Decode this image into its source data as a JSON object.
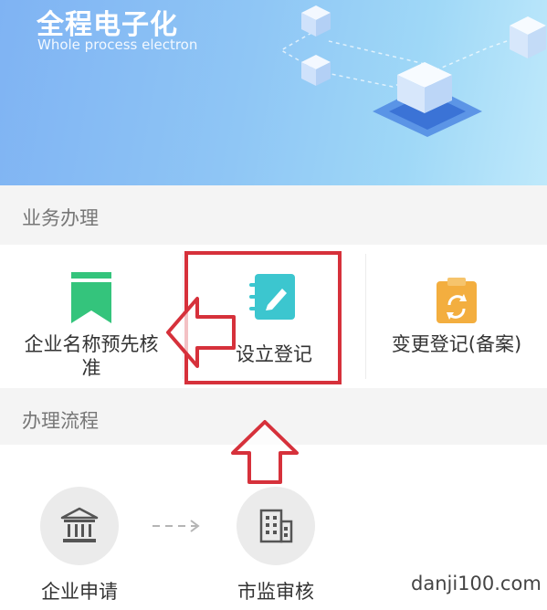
{
  "banner": {
    "title": "全程电子化",
    "subtitle": "Whole process electron"
  },
  "business": {
    "header": "业务办理",
    "items": [
      {
        "label": "企业名称预先核准",
        "icon": "bookmark-icon",
        "color": "#34c47c"
      },
      {
        "label": "设立登记",
        "icon": "edit-notebook-icon",
        "color": "#3cc6cf"
      },
      {
        "label": "变更登记(备案)",
        "icon": "refresh-clipboard-icon",
        "color": "#f3ae3f"
      }
    ]
  },
  "process": {
    "header": "办理流程",
    "steps": [
      {
        "label": "企业申请",
        "icon": "bank-icon"
      },
      {
        "label": "市监审核",
        "icon": "building-icon"
      }
    ]
  },
  "annotation_color": "#d6313b",
  "watermark": "danji100.com"
}
